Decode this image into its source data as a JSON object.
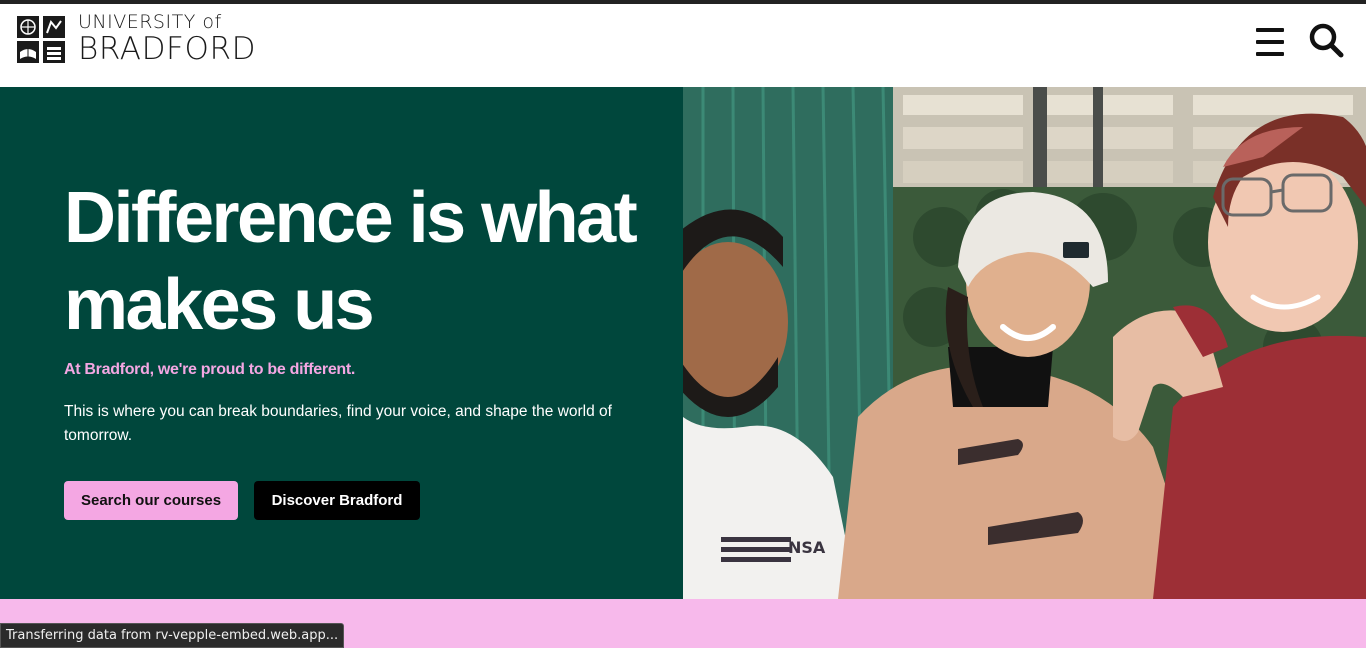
{
  "header": {
    "logo": {
      "line1": "UNIVERSITY of",
      "line2": "BRADFORD",
      "icon": "university-crest-icon"
    },
    "menu_icon": "hamburger-menu-icon",
    "search_icon": "search-icon"
  },
  "hero": {
    "title": "Difference is what makes us",
    "subtitle": "At Bradford, we're proud to be different.",
    "body": "This is where you can break boundaries, find your voice, and shape the world of tomorrow.",
    "primary_button": "Search our courses",
    "secondary_button": "Discover Bradford",
    "photo_shirt_text": "NSA"
  },
  "colors": {
    "hero_green": "#00473c",
    "accent_pink": "#f4a7e3",
    "band_pink": "#f7b9eb",
    "button_black": "#000000"
  },
  "status_bar": {
    "text": "Transferring data from rv-vepple-embed.web.app..."
  }
}
